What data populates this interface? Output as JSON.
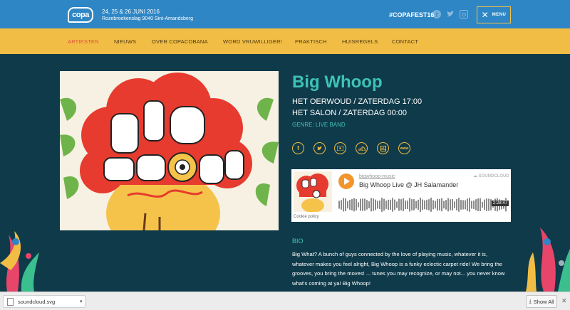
{
  "header": {
    "logo_text": "copa",
    "dates": "24, 25 & 26 JUNI 2016",
    "address": "Rozebroekenslag 9040 Sint-Amandsberg",
    "hashtag": "#COPAFEST16",
    "social": [
      "facebook-icon",
      "twitter-icon",
      "instagram-icon"
    ],
    "menu_label": "MENU",
    "menu_icon": "close-icon"
  },
  "nav": {
    "items": [
      "ARTIESTEN",
      "NIEUWS",
      "OVER COPACOBANA",
      "WORD VRUWILLIGER!",
      "PRAKTISCH",
      "HUISREGELS",
      "CONTACT"
    ],
    "active": "ARTIESTEN"
  },
  "artist": {
    "name": "Big Whoop",
    "slot1": "HET OERWOUD / ZATERDAG 17:00",
    "slot2": "HET SALON / ZATERDAG 00:00",
    "genre": "GENRE: LIVE BAND",
    "links": [
      "facebook-icon",
      "twitter-icon",
      "youtube-icon",
      "soundcloud-icon",
      "bandcamp-icon",
      "website-icon"
    ]
  },
  "soundcloud": {
    "user": "bigwhoop-music",
    "track": "Big Whoop Live @ JH Salamander",
    "brand": "SOUNDCLOUD",
    "duration": "2:28:47",
    "cookie": "Cookie policy"
  },
  "bio": {
    "heading": "BIO",
    "text": "Big What? A bunch of guys connected by the love of playing music, whatever it is, whatever makes you feel alright, Big Whoop is a funky eclectic carpet ride! We bring the grooves, you bring the moves! ... tunes you may recognize, or may not... you never know what's coming at ya! Big Whoop!"
  },
  "downloads": {
    "file": "soundcloud.svg",
    "show_all": "Show All"
  },
  "colors": {
    "topbar": "#2f86c4",
    "nav": "#f2bd45",
    "background": "#0f3a4a",
    "accent": "#3cc3b6",
    "active_nav": "#e0503c"
  }
}
